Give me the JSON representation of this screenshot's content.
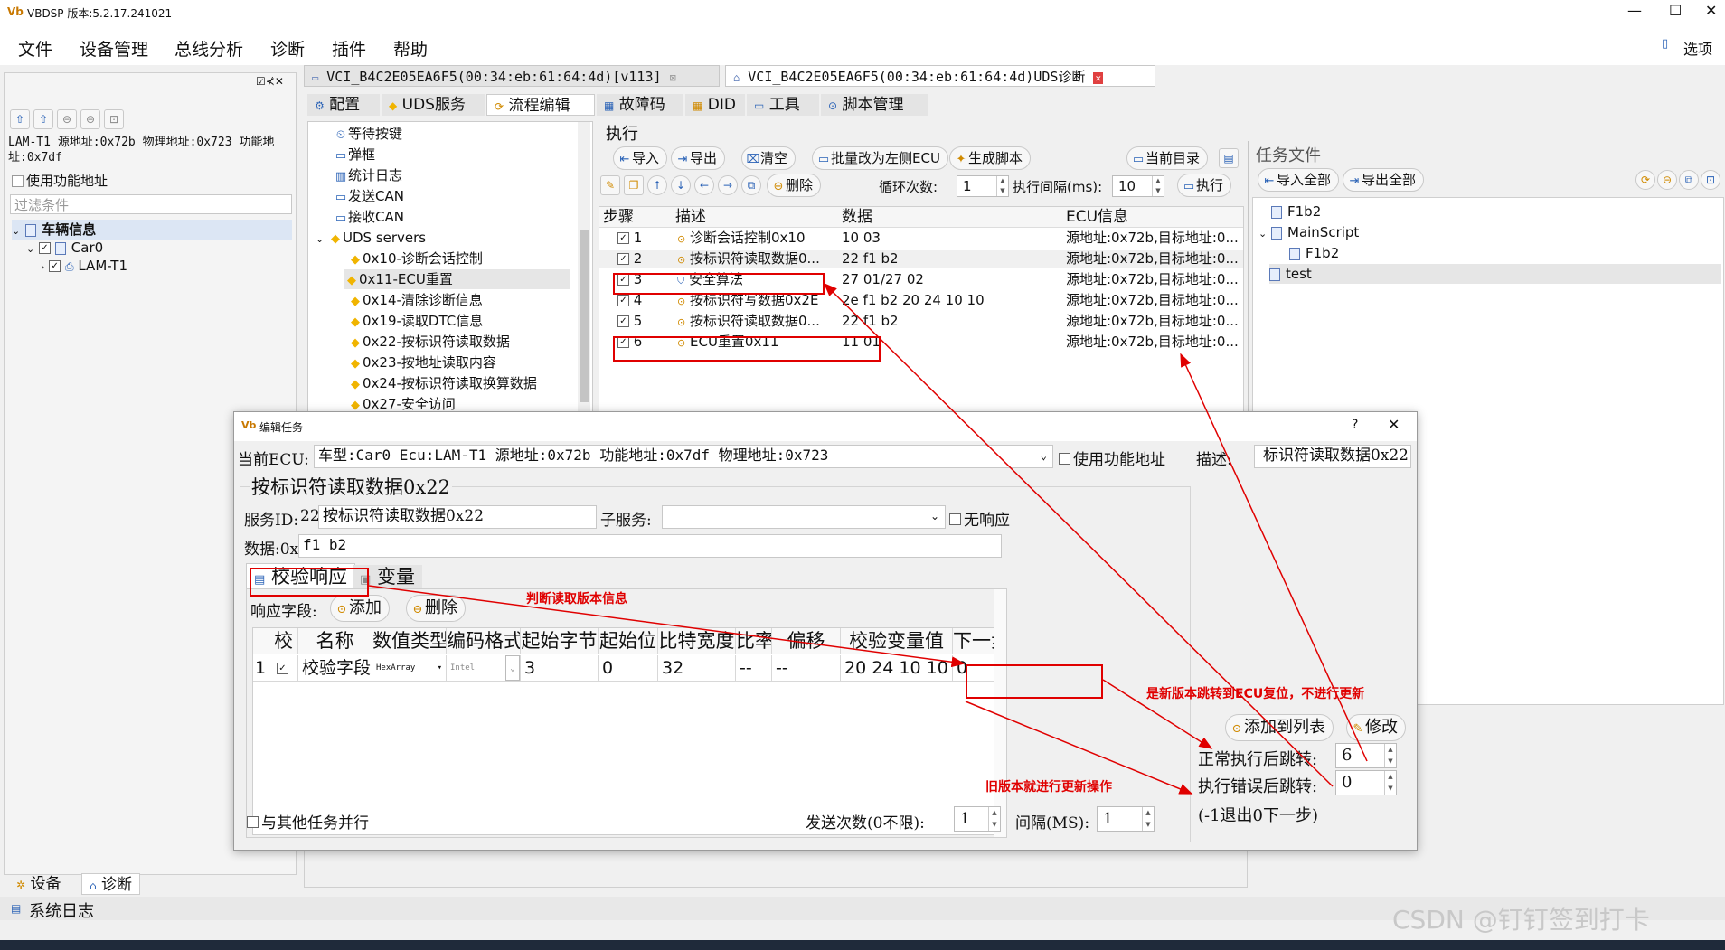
{
  "app": {
    "title": "VBDSP 版本:5.2.17.241021",
    "menus": [
      "文件",
      "设备管理",
      "总线分析",
      "诊断",
      "插件",
      "帮助"
    ],
    "options": "选项"
  },
  "left": {
    "ecu_info": "LAM-T1 源地址:0x72b 物理地址:0x723 功能地址:0x7df",
    "use_func_addr": "使用功能地址",
    "filter_placeholder": "过滤条件",
    "tree": [
      "车辆信息",
      "Car0",
      "LAM-T1"
    ],
    "bottom_tabs": [
      "设备",
      "诊断"
    ],
    "syslog": "系统日志"
  },
  "doc_tabs": [
    "VCI_B4C2E05EA6F5(00:34:eb:61:64:4d)[v113]",
    "VCI_B4C2E05EA6F5(00:34:eb:61:64:4d)UDS诊断"
  ],
  "sub_tabs": [
    "配置",
    "UDS服务",
    "流程编辑",
    "故障码",
    "DID",
    "工具",
    "脚本管理"
  ],
  "service_tree": [
    "等待按键",
    "弹框",
    "统计日志",
    "发送CAN",
    "接收CAN",
    "UDS servers",
    "0x10-诊断会话控制",
    "0x11-ECU重置",
    "0x14-清除诊断信息",
    "0x19-读取DTC信息",
    "0x22-按标识符读取数据",
    "0x23-按地址读取内容",
    "0x24-按标识符读取换算数据",
    "0x27-安全访问"
  ],
  "exec": {
    "title": "执行",
    "buttons": [
      "导入",
      "导出",
      "清空",
      "批量改为左侧ECU",
      "生成脚本",
      "当前目录"
    ],
    "delete": "删除",
    "loop_label": "循环次数:",
    "loop_value": "1",
    "interval_label": "执行间隔(ms):",
    "interval_value": "10",
    "run": "执行",
    "headers": [
      "步骤",
      "描述",
      "数据",
      "ECU信息"
    ],
    "steps": [
      {
        "n": "1",
        "desc": "诊断会话控制0x10",
        "data": "10 03",
        "ecu": "源地址:0x72b,目标地址:0..."
      },
      {
        "n": "2",
        "desc": "按标识符读取数据0...",
        "data": "22 f1 b2",
        "ecu": "源地址:0x72b,目标地址:0..."
      },
      {
        "n": "3",
        "desc": "安全算法",
        "data": "27 01/27 02",
        "ecu": "源地址:0x72b,目标地址:0..."
      },
      {
        "n": "4",
        "desc": "按标识符写数据0x2E",
        "data": "2e f1 b2 20 24 10 10",
        "ecu": "源地址:0x72b,目标地址:0..."
      },
      {
        "n": "5",
        "desc": "按标识符读取数据0...",
        "data": "22 f1 b2",
        "ecu": "源地址:0x72b,目标地址:0..."
      },
      {
        "n": "6",
        "desc": "ECU重置0x11",
        "data": "11 01",
        "ecu": "源地址:0x72b,目标地址:0..."
      }
    ]
  },
  "task_files": {
    "title": "任务文件",
    "import_all": "导入全部",
    "export_all": "导出全部",
    "tree": [
      "F1b2",
      "MainScript",
      "F1b2",
      "test"
    ]
  },
  "dialog": {
    "title": "编辑任务",
    "current_ecu_label": "当前ECU:",
    "current_ecu_value": "车型:Car0 Ecu:LAM-T1 源地址:0x72b 功能地址:0x7df 物理地址:0x723",
    "use_func_addr": "使用功能地址",
    "desc_label": "描述:",
    "desc_value": "标识符读取数据0x22",
    "group_title": "按标识符读取数据0x22",
    "service_id_label": "服务ID:",
    "service_id_value": "22",
    "service_name": "按标识符读取数据0x22",
    "sub_service_label": "子服务:",
    "no_response": "无响应",
    "data_label": "数据:0x",
    "data_value": "f1 b2",
    "tab_verify": "校验响应",
    "tab_var": "变量",
    "resp_field_label": "响应字段:",
    "add": "添加",
    "delete": "删除",
    "grid_headers": [
      "",
      "校",
      "名称",
      "数值类型",
      "编码格式",
      "起始字节",
      "起始位",
      "比特宽度",
      "比率",
      "偏移",
      "校验变量值",
      "下一步"
    ],
    "grid_row": [
      "1",
      "",
      "校验字段",
      "HexArray",
      "Intel",
      "3",
      "0",
      "32",
      "--",
      "--",
      "20 24 10 10",
      "0"
    ],
    "parallel": "与其他任务并行",
    "send_count_label": "发送次数(0不限):",
    "send_count_value": "1",
    "interval_label": "间隔(MS):",
    "interval_value": "1",
    "add_to_list": "添加到列表",
    "modify": "修改",
    "normal_jump_label": "正常执行后跳转:",
    "normal_jump_value": "6",
    "error_jump_label": "执行错误后跳转:",
    "error_jump_value": "0",
    "jump_hint": "(-1退出0下一步)"
  },
  "annotations": {
    "judge": "判断读取版本信息",
    "is_new": "是新版本跳转到ECU复位，不进行更新",
    "old": "旧版本就进行更新操作"
  },
  "watermark": "CSDN @钉钉签到打卡",
  "colors": {
    "annotation": "#e00000",
    "accent": "#2a62b6"
  }
}
